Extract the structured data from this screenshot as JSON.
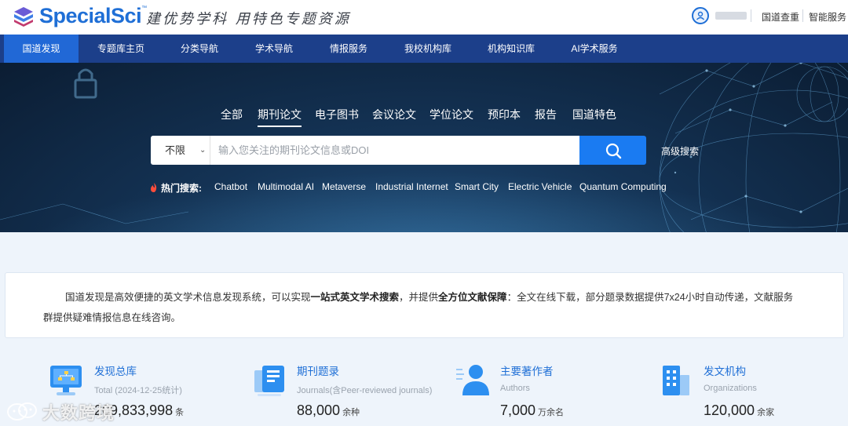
{
  "brand": {
    "name": "SpecialSci",
    "tm": "™",
    "slogan": "建优势学科 用特色专题资源"
  },
  "header": {
    "links": [
      "国道查重",
      "智能服务"
    ]
  },
  "nav": {
    "items": [
      "国道发现",
      "专题库主页",
      "分类导航",
      "学术导航",
      "情报服务",
      "我校机构库",
      "机构知识库",
      "AI学术服务"
    ],
    "active": 0
  },
  "search": {
    "tabs": [
      "全部",
      "期刊论文",
      "电子图书",
      "会议论文",
      "学位论文",
      "预印本",
      "报告",
      "国道特色"
    ],
    "active_tab": 1,
    "scope": "不限",
    "placeholder": "输入您关注的期刊论文信息或DOI",
    "value": "",
    "advanced": "高级搜索",
    "hot_label": "热门搜索:",
    "hot_terms": [
      "Chatbot",
      "Multimodal AI",
      "Metaverse",
      "Industrial Internet",
      "Smart City",
      "Electric Vehicle",
      "Quantum Computing"
    ]
  },
  "intro": {
    "p1_a": "国道发现是高效便捷的英文学术信息发现系统，可以实现",
    "p1_b": "一站式英文学术搜索",
    "p1_c": "，并提供",
    "p1_d": "全方位文献保障",
    "p1_e": "：全文在线下载，部分题录数据提供7x24小时自动传递，文献服务",
    "p2": "群提供疑难情报信息在线咨询。"
  },
  "stats": [
    {
      "title": "发现总库",
      "sub": "Total (2024-12-25统计)",
      "num": "209,833,998",
      "unit": "条"
    },
    {
      "title": "期刊题录",
      "sub": "Journals(含Peer-reviewed journals)",
      "num": "88,000",
      "unit": "余种"
    },
    {
      "title": "主要著作者",
      "sub": "Authors",
      "num": "7,000",
      "unit": "万余名"
    },
    {
      "title": "发文机构",
      "sub": "Organizations",
      "num": "120,000",
      "unit": "余家"
    }
  ],
  "watermark": "大数跨境",
  "colors": {
    "nav_bg": "#1c3f8a",
    "nav_active": "#2168d6",
    "accent": "#1a7bf2",
    "brand": "#1f6fd6"
  }
}
